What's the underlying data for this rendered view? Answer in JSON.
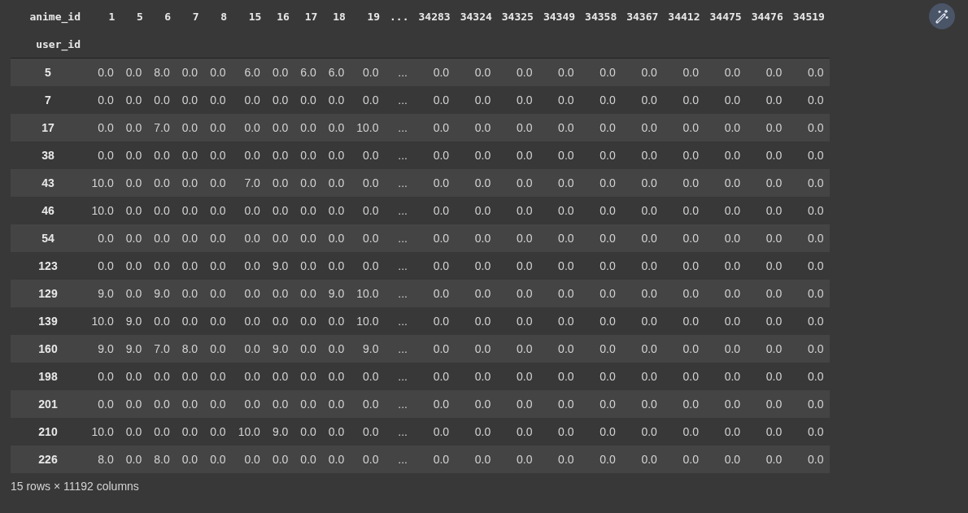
{
  "table": {
    "columns_name": "anime_id",
    "index_name": "user_id",
    "columns": [
      "1",
      "5",
      "6",
      "7",
      "8",
      "15",
      "16",
      "17",
      "18",
      "19",
      "...",
      "34283",
      "34324",
      "34325",
      "34349",
      "34358",
      "34367",
      "34412",
      "34475",
      "34476",
      "34519"
    ],
    "rows": [
      {
        "index": "5",
        "cells": [
          "0.0",
          "0.0",
          "8.0",
          "0.0",
          "0.0",
          "6.0",
          "0.0",
          "6.0",
          "6.0",
          "0.0",
          "...",
          "0.0",
          "0.0",
          "0.0",
          "0.0",
          "0.0",
          "0.0",
          "0.0",
          "0.0",
          "0.0",
          "0.0"
        ]
      },
      {
        "index": "7",
        "cells": [
          "0.0",
          "0.0",
          "0.0",
          "0.0",
          "0.0",
          "0.0",
          "0.0",
          "0.0",
          "0.0",
          "0.0",
          "...",
          "0.0",
          "0.0",
          "0.0",
          "0.0",
          "0.0",
          "0.0",
          "0.0",
          "0.0",
          "0.0",
          "0.0"
        ]
      },
      {
        "index": "17",
        "cells": [
          "0.0",
          "0.0",
          "7.0",
          "0.0",
          "0.0",
          "0.0",
          "0.0",
          "0.0",
          "0.0",
          "10.0",
          "...",
          "0.0",
          "0.0",
          "0.0",
          "0.0",
          "0.0",
          "0.0",
          "0.0",
          "0.0",
          "0.0",
          "0.0"
        ]
      },
      {
        "index": "38",
        "cells": [
          "0.0",
          "0.0",
          "0.0",
          "0.0",
          "0.0",
          "0.0",
          "0.0",
          "0.0",
          "0.0",
          "0.0",
          "...",
          "0.0",
          "0.0",
          "0.0",
          "0.0",
          "0.0",
          "0.0",
          "0.0",
          "0.0",
          "0.0",
          "0.0"
        ]
      },
      {
        "index": "43",
        "cells": [
          "10.0",
          "0.0",
          "0.0",
          "0.0",
          "0.0",
          "7.0",
          "0.0",
          "0.0",
          "0.0",
          "0.0",
          "...",
          "0.0",
          "0.0",
          "0.0",
          "0.0",
          "0.0",
          "0.0",
          "0.0",
          "0.0",
          "0.0",
          "0.0"
        ]
      },
      {
        "index": "46",
        "cells": [
          "10.0",
          "0.0",
          "0.0",
          "0.0",
          "0.0",
          "0.0",
          "0.0",
          "0.0",
          "0.0",
          "0.0",
          "...",
          "0.0",
          "0.0",
          "0.0",
          "0.0",
          "0.0",
          "0.0",
          "0.0",
          "0.0",
          "0.0",
          "0.0"
        ]
      },
      {
        "index": "54",
        "cells": [
          "0.0",
          "0.0",
          "0.0",
          "0.0",
          "0.0",
          "0.0",
          "0.0",
          "0.0",
          "0.0",
          "0.0",
          "...",
          "0.0",
          "0.0",
          "0.0",
          "0.0",
          "0.0",
          "0.0",
          "0.0",
          "0.0",
          "0.0",
          "0.0"
        ]
      },
      {
        "index": "123",
        "cells": [
          "0.0",
          "0.0",
          "0.0",
          "0.0",
          "0.0",
          "0.0",
          "9.0",
          "0.0",
          "0.0",
          "0.0",
          "...",
          "0.0",
          "0.0",
          "0.0",
          "0.0",
          "0.0",
          "0.0",
          "0.0",
          "0.0",
          "0.0",
          "0.0"
        ]
      },
      {
        "index": "129",
        "cells": [
          "9.0",
          "0.0",
          "9.0",
          "0.0",
          "0.0",
          "0.0",
          "0.0",
          "0.0",
          "9.0",
          "10.0",
          "...",
          "0.0",
          "0.0",
          "0.0",
          "0.0",
          "0.0",
          "0.0",
          "0.0",
          "0.0",
          "0.0",
          "0.0"
        ]
      },
      {
        "index": "139",
        "cells": [
          "10.0",
          "9.0",
          "0.0",
          "0.0",
          "0.0",
          "0.0",
          "0.0",
          "0.0",
          "0.0",
          "10.0",
          "...",
          "0.0",
          "0.0",
          "0.0",
          "0.0",
          "0.0",
          "0.0",
          "0.0",
          "0.0",
          "0.0",
          "0.0"
        ]
      },
      {
        "index": "160",
        "cells": [
          "9.0",
          "9.0",
          "7.0",
          "8.0",
          "0.0",
          "0.0",
          "9.0",
          "0.0",
          "0.0",
          "9.0",
          "...",
          "0.0",
          "0.0",
          "0.0",
          "0.0",
          "0.0",
          "0.0",
          "0.0",
          "0.0",
          "0.0",
          "0.0"
        ]
      },
      {
        "index": "198",
        "cells": [
          "0.0",
          "0.0",
          "0.0",
          "0.0",
          "0.0",
          "0.0",
          "0.0",
          "0.0",
          "0.0",
          "0.0",
          "...",
          "0.0",
          "0.0",
          "0.0",
          "0.0",
          "0.0",
          "0.0",
          "0.0",
          "0.0",
          "0.0",
          "0.0"
        ]
      },
      {
        "index": "201",
        "cells": [
          "0.0",
          "0.0",
          "0.0",
          "0.0",
          "0.0",
          "0.0",
          "0.0",
          "0.0",
          "0.0",
          "0.0",
          "...",
          "0.0",
          "0.0",
          "0.0",
          "0.0",
          "0.0",
          "0.0",
          "0.0",
          "0.0",
          "0.0",
          "0.0"
        ]
      },
      {
        "index": "210",
        "cells": [
          "10.0",
          "0.0",
          "0.0",
          "0.0",
          "0.0",
          "10.0",
          "9.0",
          "0.0",
          "0.0",
          "0.0",
          "...",
          "0.0",
          "0.0",
          "0.0",
          "0.0",
          "0.0",
          "0.0",
          "0.0",
          "0.0",
          "0.0",
          "0.0"
        ]
      },
      {
        "index": "226",
        "cells": [
          "8.0",
          "0.0",
          "8.0",
          "0.0",
          "0.0",
          "0.0",
          "0.0",
          "0.0",
          "0.0",
          "0.0",
          "...",
          "0.0",
          "0.0",
          "0.0",
          "0.0",
          "0.0",
          "0.0",
          "0.0",
          "0.0",
          "0.0",
          "0.0"
        ]
      }
    ]
  },
  "summary": "15 rows × 11192 columns"
}
